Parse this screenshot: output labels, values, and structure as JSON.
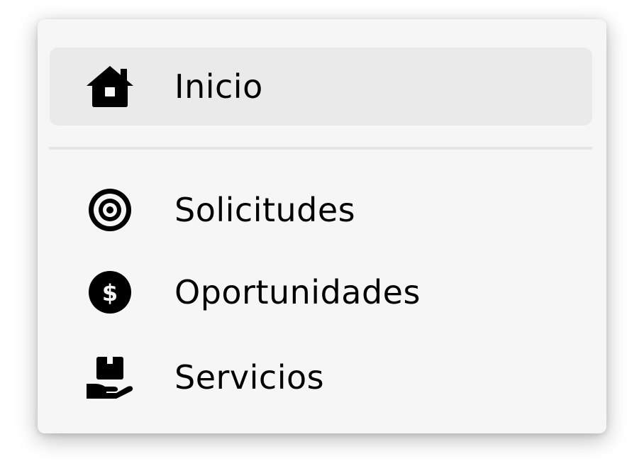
{
  "menu": {
    "items": [
      {
        "label": "Inicio",
        "icon": "home-icon",
        "active": true
      },
      {
        "label": "Solicitudes",
        "icon": "target-icon",
        "active": false
      },
      {
        "label": "Oportunidades",
        "icon": "dollar-circle-icon",
        "active": false
      },
      {
        "label": "Servicios",
        "icon": "hand-box-icon",
        "active": false
      }
    ]
  },
  "colors": {
    "panel_background": "#f6f6f6",
    "active_background": "#eaeaea",
    "divider": "#e5e5e5",
    "text": "#000000"
  }
}
